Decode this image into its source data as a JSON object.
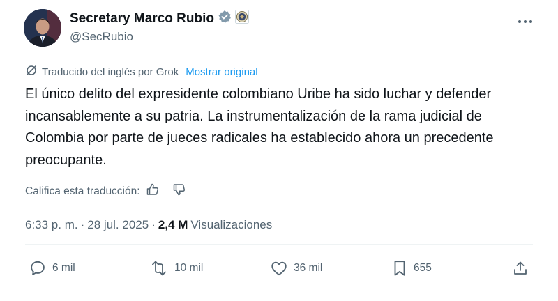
{
  "author": {
    "name": "Secretary Marco Rubio",
    "handle": "@SecRubio",
    "verified_badge_color": "#829aab"
  },
  "translation": {
    "label": "Traducido del inglés por Grok",
    "show_original": "Mostrar original"
  },
  "post": {
    "text": "El único delito del expresidente colombiano Uribe ha sido luchar y defender incansablemente a su patria. La instrumentalización de la rama judicial de Colombia por parte de jueces radicales ha establecido ahora un precedente preocupante."
  },
  "rating": {
    "label": "Califica esta traducción:"
  },
  "meta": {
    "time": "6:33 p. m.",
    "separator": "·",
    "date": "28 jul. 2025",
    "views_count": "2,4 M",
    "views_label": "Visualizaciones"
  },
  "actions": {
    "replies": "6 mil",
    "reposts": "10 mil",
    "likes": "36 mil",
    "bookmarks": "655"
  },
  "colors": {
    "text": "#0f1419",
    "secondary": "#536471",
    "link": "#1d9bf0",
    "divider": "#eff3f4"
  }
}
